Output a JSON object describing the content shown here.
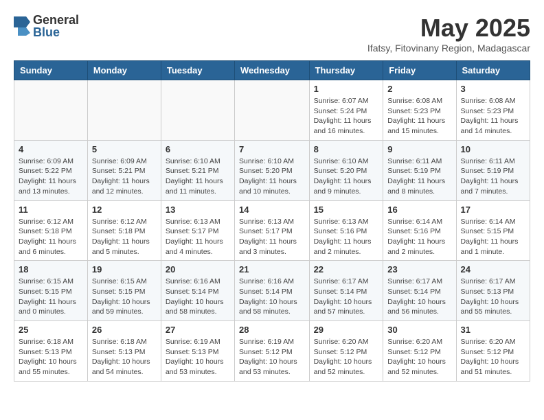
{
  "header": {
    "logo_general": "General",
    "logo_blue": "Blue",
    "title": "May 2025",
    "subtitle": "Ifatsy, Fitovinany Region, Madagascar"
  },
  "weekdays": [
    "Sunday",
    "Monday",
    "Tuesday",
    "Wednesday",
    "Thursday",
    "Friday",
    "Saturday"
  ],
  "weeks": [
    [
      {
        "day": "",
        "sunrise": "",
        "sunset": "",
        "daylight": ""
      },
      {
        "day": "",
        "sunrise": "",
        "sunset": "",
        "daylight": ""
      },
      {
        "day": "",
        "sunrise": "",
        "sunset": "",
        "daylight": ""
      },
      {
        "day": "",
        "sunrise": "",
        "sunset": "",
        "daylight": ""
      },
      {
        "day": "1",
        "sunrise": "Sunrise: 6:07 AM",
        "sunset": "Sunset: 5:24 PM",
        "daylight": "Daylight: 11 hours and 16 minutes."
      },
      {
        "day": "2",
        "sunrise": "Sunrise: 6:08 AM",
        "sunset": "Sunset: 5:23 PM",
        "daylight": "Daylight: 11 hours and 15 minutes."
      },
      {
        "day": "3",
        "sunrise": "Sunrise: 6:08 AM",
        "sunset": "Sunset: 5:23 PM",
        "daylight": "Daylight: 11 hours and 14 minutes."
      }
    ],
    [
      {
        "day": "4",
        "sunrise": "Sunrise: 6:09 AM",
        "sunset": "Sunset: 5:22 PM",
        "daylight": "Daylight: 11 hours and 13 minutes."
      },
      {
        "day": "5",
        "sunrise": "Sunrise: 6:09 AM",
        "sunset": "Sunset: 5:21 PM",
        "daylight": "Daylight: 11 hours and 12 minutes."
      },
      {
        "day": "6",
        "sunrise": "Sunrise: 6:10 AM",
        "sunset": "Sunset: 5:21 PM",
        "daylight": "Daylight: 11 hours and 11 minutes."
      },
      {
        "day": "7",
        "sunrise": "Sunrise: 6:10 AM",
        "sunset": "Sunset: 5:20 PM",
        "daylight": "Daylight: 11 hours and 10 minutes."
      },
      {
        "day": "8",
        "sunrise": "Sunrise: 6:10 AM",
        "sunset": "Sunset: 5:20 PM",
        "daylight": "Daylight: 11 hours and 9 minutes."
      },
      {
        "day": "9",
        "sunrise": "Sunrise: 6:11 AM",
        "sunset": "Sunset: 5:19 PM",
        "daylight": "Daylight: 11 hours and 8 minutes."
      },
      {
        "day": "10",
        "sunrise": "Sunrise: 6:11 AM",
        "sunset": "Sunset: 5:19 PM",
        "daylight": "Daylight: 11 hours and 7 minutes."
      }
    ],
    [
      {
        "day": "11",
        "sunrise": "Sunrise: 6:12 AM",
        "sunset": "Sunset: 5:18 PM",
        "daylight": "Daylight: 11 hours and 6 minutes."
      },
      {
        "day": "12",
        "sunrise": "Sunrise: 6:12 AM",
        "sunset": "Sunset: 5:18 PM",
        "daylight": "Daylight: 11 hours and 5 minutes."
      },
      {
        "day": "13",
        "sunrise": "Sunrise: 6:13 AM",
        "sunset": "Sunset: 5:17 PM",
        "daylight": "Daylight: 11 hours and 4 minutes."
      },
      {
        "day": "14",
        "sunrise": "Sunrise: 6:13 AM",
        "sunset": "Sunset: 5:17 PM",
        "daylight": "Daylight: 11 hours and 3 minutes."
      },
      {
        "day": "15",
        "sunrise": "Sunrise: 6:13 AM",
        "sunset": "Sunset: 5:16 PM",
        "daylight": "Daylight: 11 hours and 2 minutes."
      },
      {
        "day": "16",
        "sunrise": "Sunrise: 6:14 AM",
        "sunset": "Sunset: 5:16 PM",
        "daylight": "Daylight: 11 hours and 2 minutes."
      },
      {
        "day": "17",
        "sunrise": "Sunrise: 6:14 AM",
        "sunset": "Sunset: 5:15 PM",
        "daylight": "Daylight: 11 hours and 1 minute."
      }
    ],
    [
      {
        "day": "18",
        "sunrise": "Sunrise: 6:15 AM",
        "sunset": "Sunset: 5:15 PM",
        "daylight": "Daylight: 11 hours and 0 minutes."
      },
      {
        "day": "19",
        "sunrise": "Sunrise: 6:15 AM",
        "sunset": "Sunset: 5:15 PM",
        "daylight": "Daylight: 10 hours and 59 minutes."
      },
      {
        "day": "20",
        "sunrise": "Sunrise: 6:16 AM",
        "sunset": "Sunset: 5:14 PM",
        "daylight": "Daylight: 10 hours and 58 minutes."
      },
      {
        "day": "21",
        "sunrise": "Sunrise: 6:16 AM",
        "sunset": "Sunset: 5:14 PM",
        "daylight": "Daylight: 10 hours and 58 minutes."
      },
      {
        "day": "22",
        "sunrise": "Sunrise: 6:17 AM",
        "sunset": "Sunset: 5:14 PM",
        "daylight": "Daylight: 10 hours and 57 minutes."
      },
      {
        "day": "23",
        "sunrise": "Sunrise: 6:17 AM",
        "sunset": "Sunset: 5:14 PM",
        "daylight": "Daylight: 10 hours and 56 minutes."
      },
      {
        "day": "24",
        "sunrise": "Sunrise: 6:17 AM",
        "sunset": "Sunset: 5:13 PM",
        "daylight": "Daylight: 10 hours and 55 minutes."
      }
    ],
    [
      {
        "day": "25",
        "sunrise": "Sunrise: 6:18 AM",
        "sunset": "Sunset: 5:13 PM",
        "daylight": "Daylight: 10 hours and 55 minutes."
      },
      {
        "day": "26",
        "sunrise": "Sunrise: 6:18 AM",
        "sunset": "Sunset: 5:13 PM",
        "daylight": "Daylight: 10 hours and 54 minutes."
      },
      {
        "day": "27",
        "sunrise": "Sunrise: 6:19 AM",
        "sunset": "Sunset: 5:13 PM",
        "daylight": "Daylight: 10 hours and 53 minutes."
      },
      {
        "day": "28",
        "sunrise": "Sunrise: 6:19 AM",
        "sunset": "Sunset: 5:12 PM",
        "daylight": "Daylight: 10 hours and 53 minutes."
      },
      {
        "day": "29",
        "sunrise": "Sunrise: 6:20 AM",
        "sunset": "Sunset: 5:12 PM",
        "daylight": "Daylight: 10 hours and 52 minutes."
      },
      {
        "day": "30",
        "sunrise": "Sunrise: 6:20 AM",
        "sunset": "Sunset: 5:12 PM",
        "daylight": "Daylight: 10 hours and 52 minutes."
      },
      {
        "day": "31",
        "sunrise": "Sunrise: 6:20 AM",
        "sunset": "Sunset: 5:12 PM",
        "daylight": "Daylight: 10 hours and 51 minutes."
      }
    ]
  ]
}
